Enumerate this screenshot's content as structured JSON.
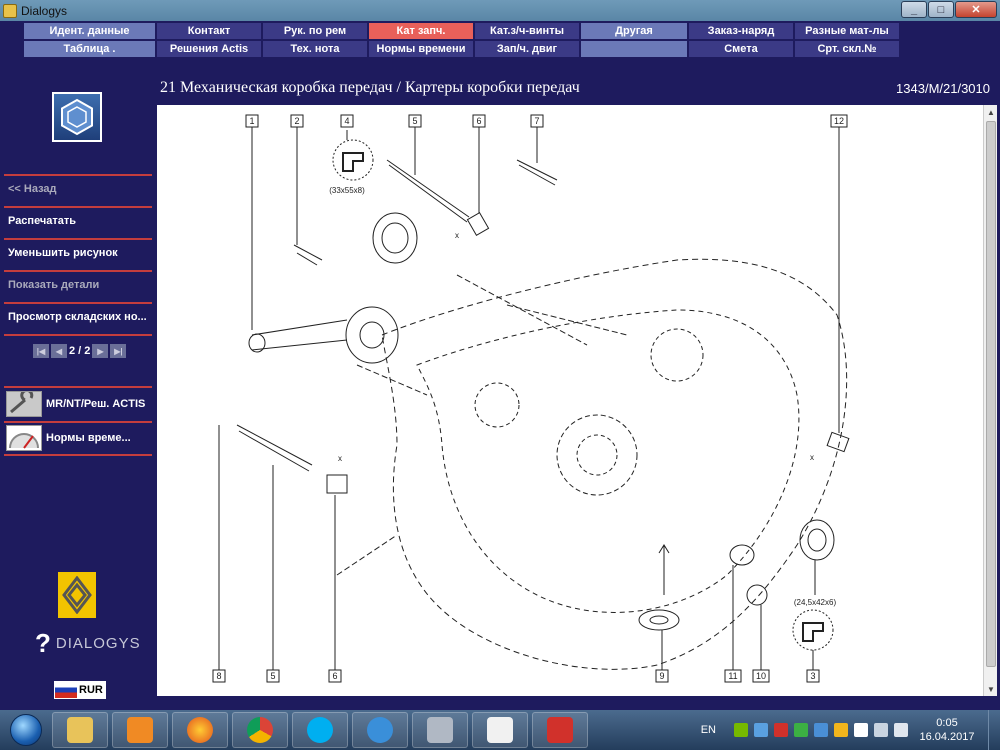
{
  "window": {
    "title": "Dialogys"
  },
  "menu": {
    "row1": [
      {
        "label": "Идент. данные"
      },
      {
        "label": "Контакт"
      },
      {
        "label": "Рук. по рем"
      },
      {
        "label": "Кат запч."
      },
      {
        "label": "Кат.з/ч-винты"
      },
      {
        "label": "Другая"
      },
      {
        "label": "Заказ-наряд"
      },
      {
        "label": "Разные мат-лы"
      }
    ],
    "row2": [
      {
        "label": "Таблица ."
      },
      {
        "label": "Решения Actis"
      },
      {
        "label": "Тех. нота"
      },
      {
        "label": "Нормы времени"
      },
      {
        "label": "Зап/ч. двиг"
      },
      {
        "label": ""
      },
      {
        "label": "Смета"
      },
      {
        "label": "Срт. скл.№"
      }
    ],
    "active": "Кат запч."
  },
  "sidebar": {
    "back": "<< Назад",
    "print": "Распечатать",
    "zoom_out": "Уменьшить рисунок",
    "show_details": "Показать детали",
    "stock_view": "Просмотр складских но...",
    "pager": "2 / 2",
    "tool1": "MR/NT/Реш. ACTIS",
    "tool2": "Нормы време...",
    "brand": "DIALOGYS",
    "currency": "RUR"
  },
  "page": {
    "heading": "21 Механическая коробка передач / Картеры коробки передач",
    "ref": "1343/M/21/3010"
  },
  "diagram": {
    "callouts_top": [
      "1",
      "2",
      "4",
      "5",
      "6",
      "7",
      "12"
    ],
    "callouts_bottom": [
      "8",
      "5",
      "6",
      "9",
      "11",
      "10",
      "3"
    ],
    "dim_top": "(33x55x8)",
    "dim_bottom": "(24,5x42x6)",
    "x_marks": [
      "x",
      "x",
      "x"
    ]
  },
  "taskbar": {
    "lang": "EN",
    "time": "0:05",
    "date": "16.04.2017"
  },
  "colors": {
    "background": "#1e1b5e",
    "menu_cell": "#3b3a86",
    "menu_light": "#6b79b8",
    "active": "#e8605a",
    "separator": "#c43d3d"
  }
}
